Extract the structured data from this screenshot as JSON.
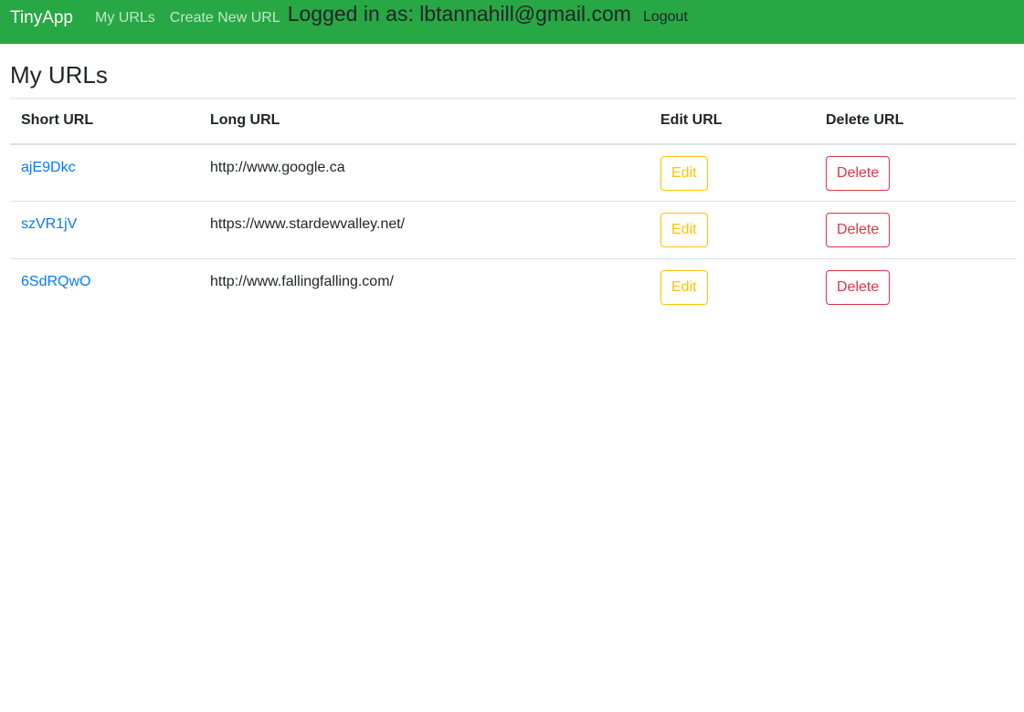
{
  "navbar": {
    "brand": "TinyApp",
    "links": {
      "my_urls": "My URLs",
      "create_new": "Create New URL"
    },
    "logged_in_text": "Logged in as: lbtannahill@gmail.com",
    "logout_label": "Logout",
    "bg_color": "#28a745"
  },
  "main": {
    "title": "My URLs",
    "table": {
      "headers": {
        "short": "Short URL",
        "long": "Long URL",
        "edit": "Edit URL",
        "delete": "Delete URL"
      },
      "rows": [
        {
          "short_url": "ajE9Dkc",
          "long_url": "http://www.google.ca",
          "edit_label": "Edit",
          "delete_label": "Delete"
        },
        {
          "short_url": "szVR1jV",
          "long_url": "https://www.stardewvalley.net/",
          "edit_label": "Edit",
          "delete_label": "Delete"
        },
        {
          "short_url": "6SdRQwO",
          "long_url": "http://www.fallingfalling.com/",
          "edit_label": "Edit",
          "delete_label": "Delete"
        }
      ]
    }
  },
  "colors": {
    "link": "#007bff",
    "edit": "#ffc107",
    "delete": "#dc3545"
  }
}
